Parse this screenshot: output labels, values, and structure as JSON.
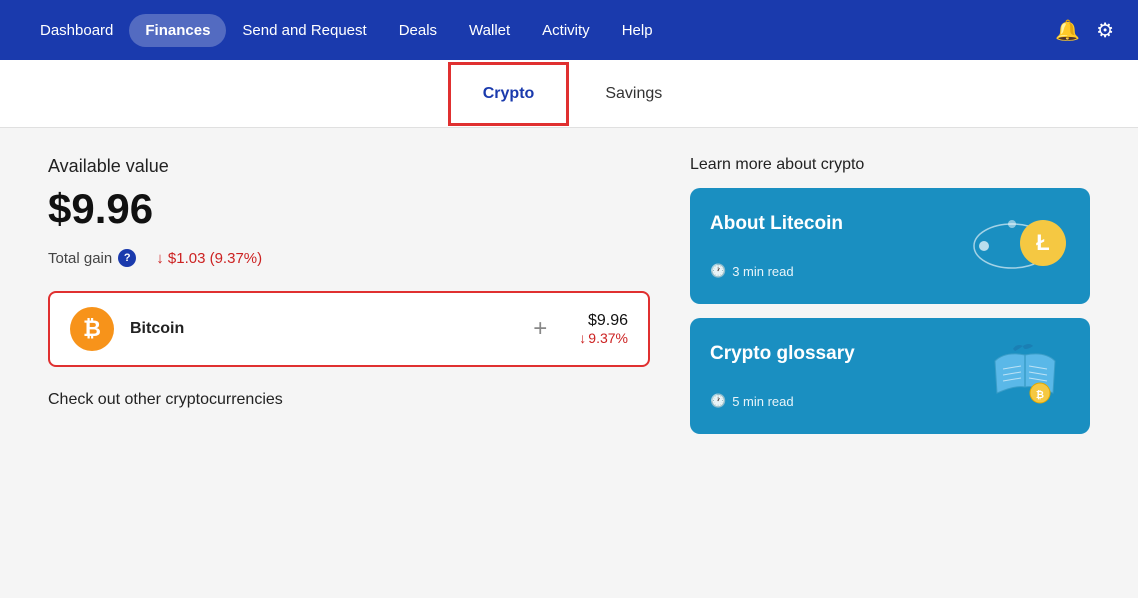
{
  "nav": {
    "items": [
      {
        "id": "dashboard",
        "label": "Dashboard",
        "active": false
      },
      {
        "id": "finances",
        "label": "Finances",
        "active": true
      },
      {
        "id": "send-request",
        "label": "Send and Request",
        "active": false
      },
      {
        "id": "deals",
        "label": "Deals",
        "active": false
      },
      {
        "id": "wallet",
        "label": "Wallet",
        "active": false
      },
      {
        "id": "activity",
        "label": "Activity",
        "active": false
      },
      {
        "id": "help",
        "label": "Help",
        "active": false
      }
    ]
  },
  "tabs": [
    {
      "id": "crypto",
      "label": "Crypto",
      "active": true
    },
    {
      "id": "savings",
      "label": "Savings",
      "active": false
    }
  ],
  "main": {
    "available_label": "Available value",
    "available_value": "$9.96",
    "total_gain_label": "Total gain",
    "total_gain_value": "$1.03 (9.37%)",
    "bitcoin": {
      "name": "Bitcoin",
      "amount": "$9.96",
      "change": "9.37%",
      "plus_symbol": "+"
    },
    "check_other_label": "Check out other cryptocurrencies"
  },
  "sidebar": {
    "learn_label": "Learn more about crypto",
    "cards": [
      {
        "id": "litecoin",
        "title": "About Litecoin",
        "time": "3 min read"
      },
      {
        "id": "glossary",
        "title": "Crypto glossary",
        "time": "5 min read"
      }
    ]
  }
}
